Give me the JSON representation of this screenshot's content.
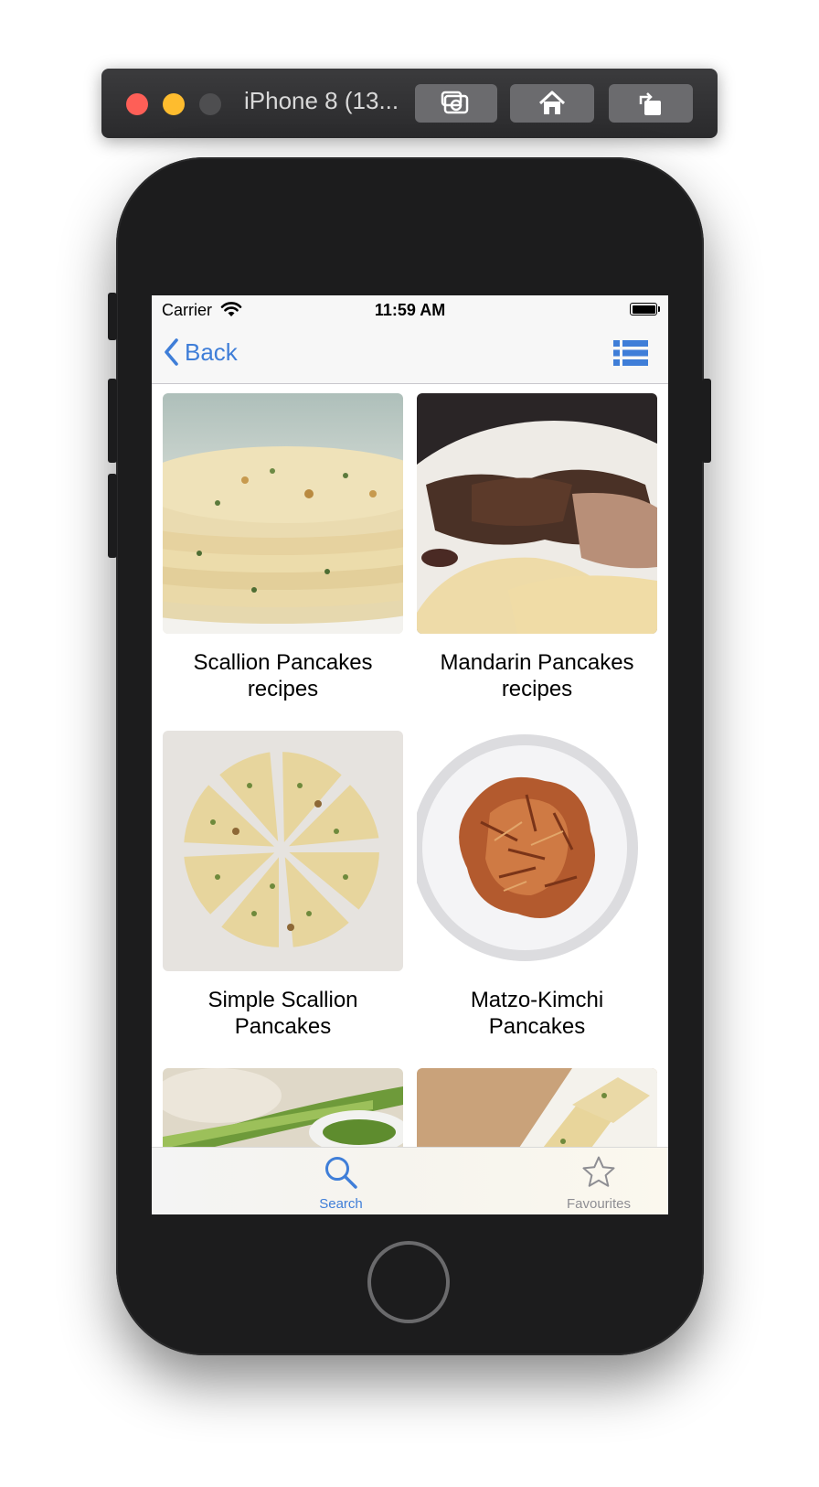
{
  "simulator": {
    "title": "iPhone 8 (13..."
  },
  "status_bar": {
    "carrier": "Carrier",
    "time": "11:59 AM"
  },
  "nav": {
    "back_label": "Back"
  },
  "recipes": [
    {
      "title_line1": "Scallion Pancakes",
      "title_line2": "recipes"
    },
    {
      "title_line1": "Mandarin Pancakes",
      "title_line2": "recipes"
    },
    {
      "title_line1": "Simple Scallion",
      "title_line2": "Pancakes"
    },
    {
      "title_line1": "Matzo-Kimchi",
      "title_line2": "Pancakes"
    }
  ],
  "tabs": [
    {
      "label": "Search",
      "icon": "search-icon",
      "selected": true
    },
    {
      "label": "Favourites",
      "icon": "star-icon",
      "selected": false
    }
  ],
  "colors": {
    "accent": "#3f7ed8",
    "inactive_tab": "#8e8e93"
  }
}
